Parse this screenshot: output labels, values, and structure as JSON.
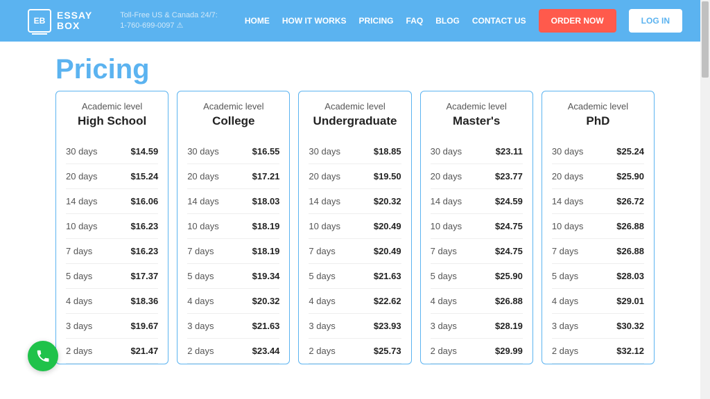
{
  "header": {
    "logo_line1": "ESSAY",
    "logo_line2": "BOX",
    "logo_badge": "EB",
    "toll_label": "Toll-Free US & Canada 24/7:",
    "toll_phone": "1-760-699-0097 ⚠",
    "nav": [
      "HOME",
      "HOW IT WORKS",
      "PRICING",
      "FAQ",
      "BLOG",
      "CONTACT US"
    ],
    "order_btn": "ORDER NOW",
    "login_btn": "LOG IN"
  },
  "page_title": "Pricing",
  "sub_label": "Academic level",
  "deadlines": [
    "30 days",
    "20 days",
    "14 days",
    "10 days",
    "7 days",
    "5 days",
    "4 days",
    "3 days",
    "2 days"
  ],
  "cards": [
    {
      "title": "High School",
      "prices": [
        "$14.59",
        "$15.24",
        "$16.06",
        "$16.23",
        "$16.23",
        "$17.37",
        "$18.36",
        "$19.67",
        "$21.47"
      ]
    },
    {
      "title": "College",
      "prices": [
        "$16.55",
        "$17.21",
        "$18.03",
        "$18.19",
        "$18.19",
        "$19.34",
        "$20.32",
        "$21.63",
        "$23.44"
      ]
    },
    {
      "title": "Undergraduate",
      "prices": [
        "$18.85",
        "$19.50",
        "$20.32",
        "$20.49",
        "$20.49",
        "$21.63",
        "$22.62",
        "$23.93",
        "$25.73"
      ]
    },
    {
      "title": "Master's",
      "prices": [
        "$23.11",
        "$23.77",
        "$24.59",
        "$24.75",
        "$24.75",
        "$25.90",
        "$26.88",
        "$28.19",
        "$29.99"
      ]
    },
    {
      "title": "PhD",
      "prices": [
        "$25.24",
        "$25.90",
        "$26.72",
        "$26.88",
        "$26.88",
        "$28.03",
        "$29.01",
        "$30.32",
        "$32.12"
      ]
    }
  ]
}
